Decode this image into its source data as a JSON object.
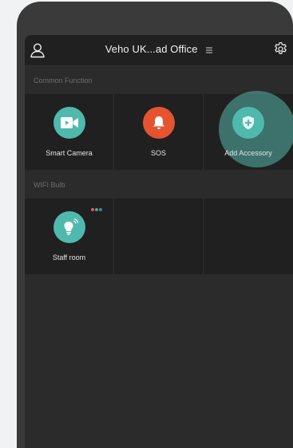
{
  "header": {
    "title": "Veho UK...ad Office"
  },
  "sections": {
    "common": {
      "label": "Common Function",
      "items": [
        {
          "label": "Smart Camera",
          "icon": "video-camera-icon",
          "color": "#4fb9ad"
        },
        {
          "label": "SOS",
          "icon": "bell-icon",
          "color": "#e65331"
        },
        {
          "label": "Add Accessory",
          "icon": "shield-plus-icon",
          "color": "#4fb9ad"
        }
      ]
    },
    "wifi": {
      "label": "WIFI Bulb",
      "items": [
        {
          "label": "Staff room",
          "icon": "light-bulb-icon",
          "color": "#4fb9ad"
        }
      ],
      "status_dot_colors": [
        "#e0507c",
        "#4caf50",
        "#3b82c4"
      ]
    }
  },
  "colors": {
    "background": "#202020",
    "accent": "#4fb9ad",
    "alert": "#e65331"
  }
}
